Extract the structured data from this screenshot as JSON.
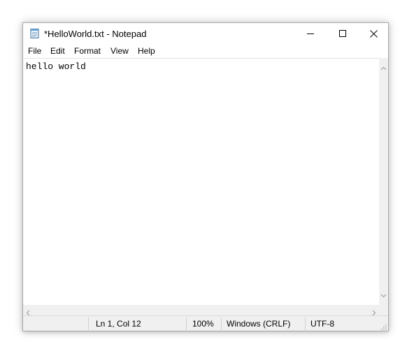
{
  "window": {
    "title": "*HelloWorld.txt - Notepad"
  },
  "menu": {
    "file": "File",
    "edit": "Edit",
    "format": "Format",
    "view": "View",
    "help": "Help"
  },
  "editor": {
    "content": "hello world"
  },
  "status": {
    "position": "Ln 1, Col 12",
    "zoom": "100%",
    "line_ending": "Windows (CRLF)",
    "encoding": "UTF-8"
  },
  "icons": {
    "app": "notepad-icon",
    "minimize": "minimize-icon",
    "maximize": "maximize-icon",
    "close": "close-icon"
  }
}
